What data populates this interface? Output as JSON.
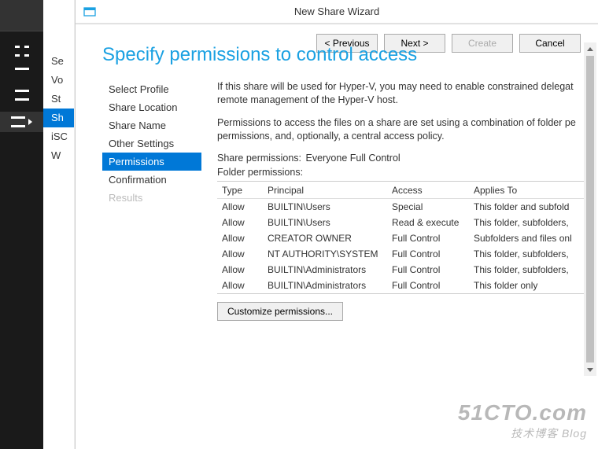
{
  "window": {
    "title": "New Share Wizard"
  },
  "mid": {
    "items": [
      "Se",
      "Vo",
      "St",
      "Sh",
      "iSC",
      "W"
    ],
    "selectedIndex": 3
  },
  "header": "Specify permissions to control access",
  "nav": [
    {
      "label": "Select Profile",
      "state": "normal"
    },
    {
      "label": "Share Location",
      "state": "normal"
    },
    {
      "label": "Share Name",
      "state": "normal"
    },
    {
      "label": "Other Settings",
      "state": "normal"
    },
    {
      "label": "Permissions",
      "state": "active"
    },
    {
      "label": "Confirmation",
      "state": "normal"
    },
    {
      "label": "Results",
      "state": "disabled"
    }
  ],
  "content": {
    "desc1": "If this share will be used for Hyper-V, you may need to enable constrained delegat remote management of the Hyper-V host.",
    "desc2": "Permissions to access the files on a share are set using a combination of folder pe permissions, and, optionally, a central access policy.",
    "sharePermLabel": "Share permissions:",
    "sharePermValue": "Everyone Full Control",
    "folderPermLabel": "Folder permissions:",
    "cols": {
      "type": "Type",
      "principal": "Principal",
      "access": "Access",
      "applies": "Applies To"
    },
    "rows": [
      {
        "type": "Allow",
        "principal": "BUILTIN\\Users",
        "access": "Special",
        "applies": "This folder and subfold"
      },
      {
        "type": "Allow",
        "principal": "BUILTIN\\Users",
        "access": "Read & execute",
        "applies": "This folder, subfolders,"
      },
      {
        "type": "Allow",
        "principal": "CREATOR OWNER",
        "access": "Full Control",
        "applies": "Subfolders and files onl"
      },
      {
        "type": "Allow",
        "principal": "NT AUTHORITY\\SYSTEM",
        "access": "Full Control",
        "applies": "This folder, subfolders,"
      },
      {
        "type": "Allow",
        "principal": "BUILTIN\\Administrators",
        "access": "Full Control",
        "applies": "This folder, subfolders,"
      },
      {
        "type": "Allow",
        "principal": "BUILTIN\\Administrators",
        "access": "Full Control",
        "applies": "This folder only"
      }
    ],
    "customizeBtn": "Customize permissions..."
  },
  "footer": {
    "previous": "< Previous",
    "next": "Next >",
    "create": "Create",
    "cancel": "Cancel"
  },
  "watermark": {
    "main": "51CTO.com",
    "sub": "技术博客   Blog"
  }
}
